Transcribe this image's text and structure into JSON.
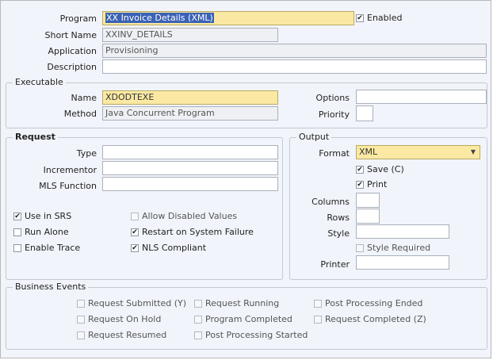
{
  "program": {
    "label": "Program",
    "value": "XX Invoice Details (XML)",
    "enabled_label": "Enabled",
    "enabled_checked": true
  },
  "short_name": {
    "label": "Short Name",
    "value": "XXINV_DETAILS"
  },
  "application": {
    "label": "Application",
    "value": "Provisioning"
  },
  "description": {
    "label": "Description",
    "value": ""
  },
  "executable": {
    "title": "Executable",
    "name_label": "Name",
    "name_value": "XDODTEXE",
    "method_label": "Method",
    "method_value": "Java Concurrent Program",
    "options_label": "Options",
    "options_value": "",
    "priority_label": "Priority",
    "priority_value": ""
  },
  "request": {
    "title": "Request",
    "type_label": "Type",
    "type_value": "",
    "incrementor_label": "Incrementor",
    "incrementor_value": "",
    "mls_label": "MLS Function",
    "mls_value": "",
    "use_in_srs": "Use in SRS",
    "run_alone": "Run Alone",
    "enable_trace": "Enable Trace",
    "allow_disabled": "Allow Disabled Values",
    "restart": "Restart on System Failure",
    "nls": "NLS Compliant"
  },
  "output": {
    "title": "Output",
    "format_label": "Format",
    "format_value": "XML",
    "save_label": "Save (C)",
    "print_label": "Print",
    "columns_label": "Columns",
    "columns_value": "",
    "rows_label": "Rows",
    "rows_value": "",
    "style_label": "Style",
    "style_value": "",
    "style_required_label": "Style Required",
    "printer_label": "Printer",
    "printer_value": ""
  },
  "business_events": {
    "title": "Business Events",
    "request_submitted": "Request Submitted (Y)",
    "request_on_hold": "Request On Hold",
    "request_resumed": "Request Resumed",
    "request_running": "Request Running",
    "program_completed": "Program Completed",
    "post_processing_started": "Post Processing Started",
    "post_processing_ended": "Post Processing Ended",
    "request_completed": "Request Completed (Z)"
  },
  "icons": {
    "check": "✔",
    "chevron": "▼"
  },
  "colors": {
    "required_field": "#fbe9a3",
    "selection": "#3a62b6",
    "background": "#f1f4fa"
  }
}
